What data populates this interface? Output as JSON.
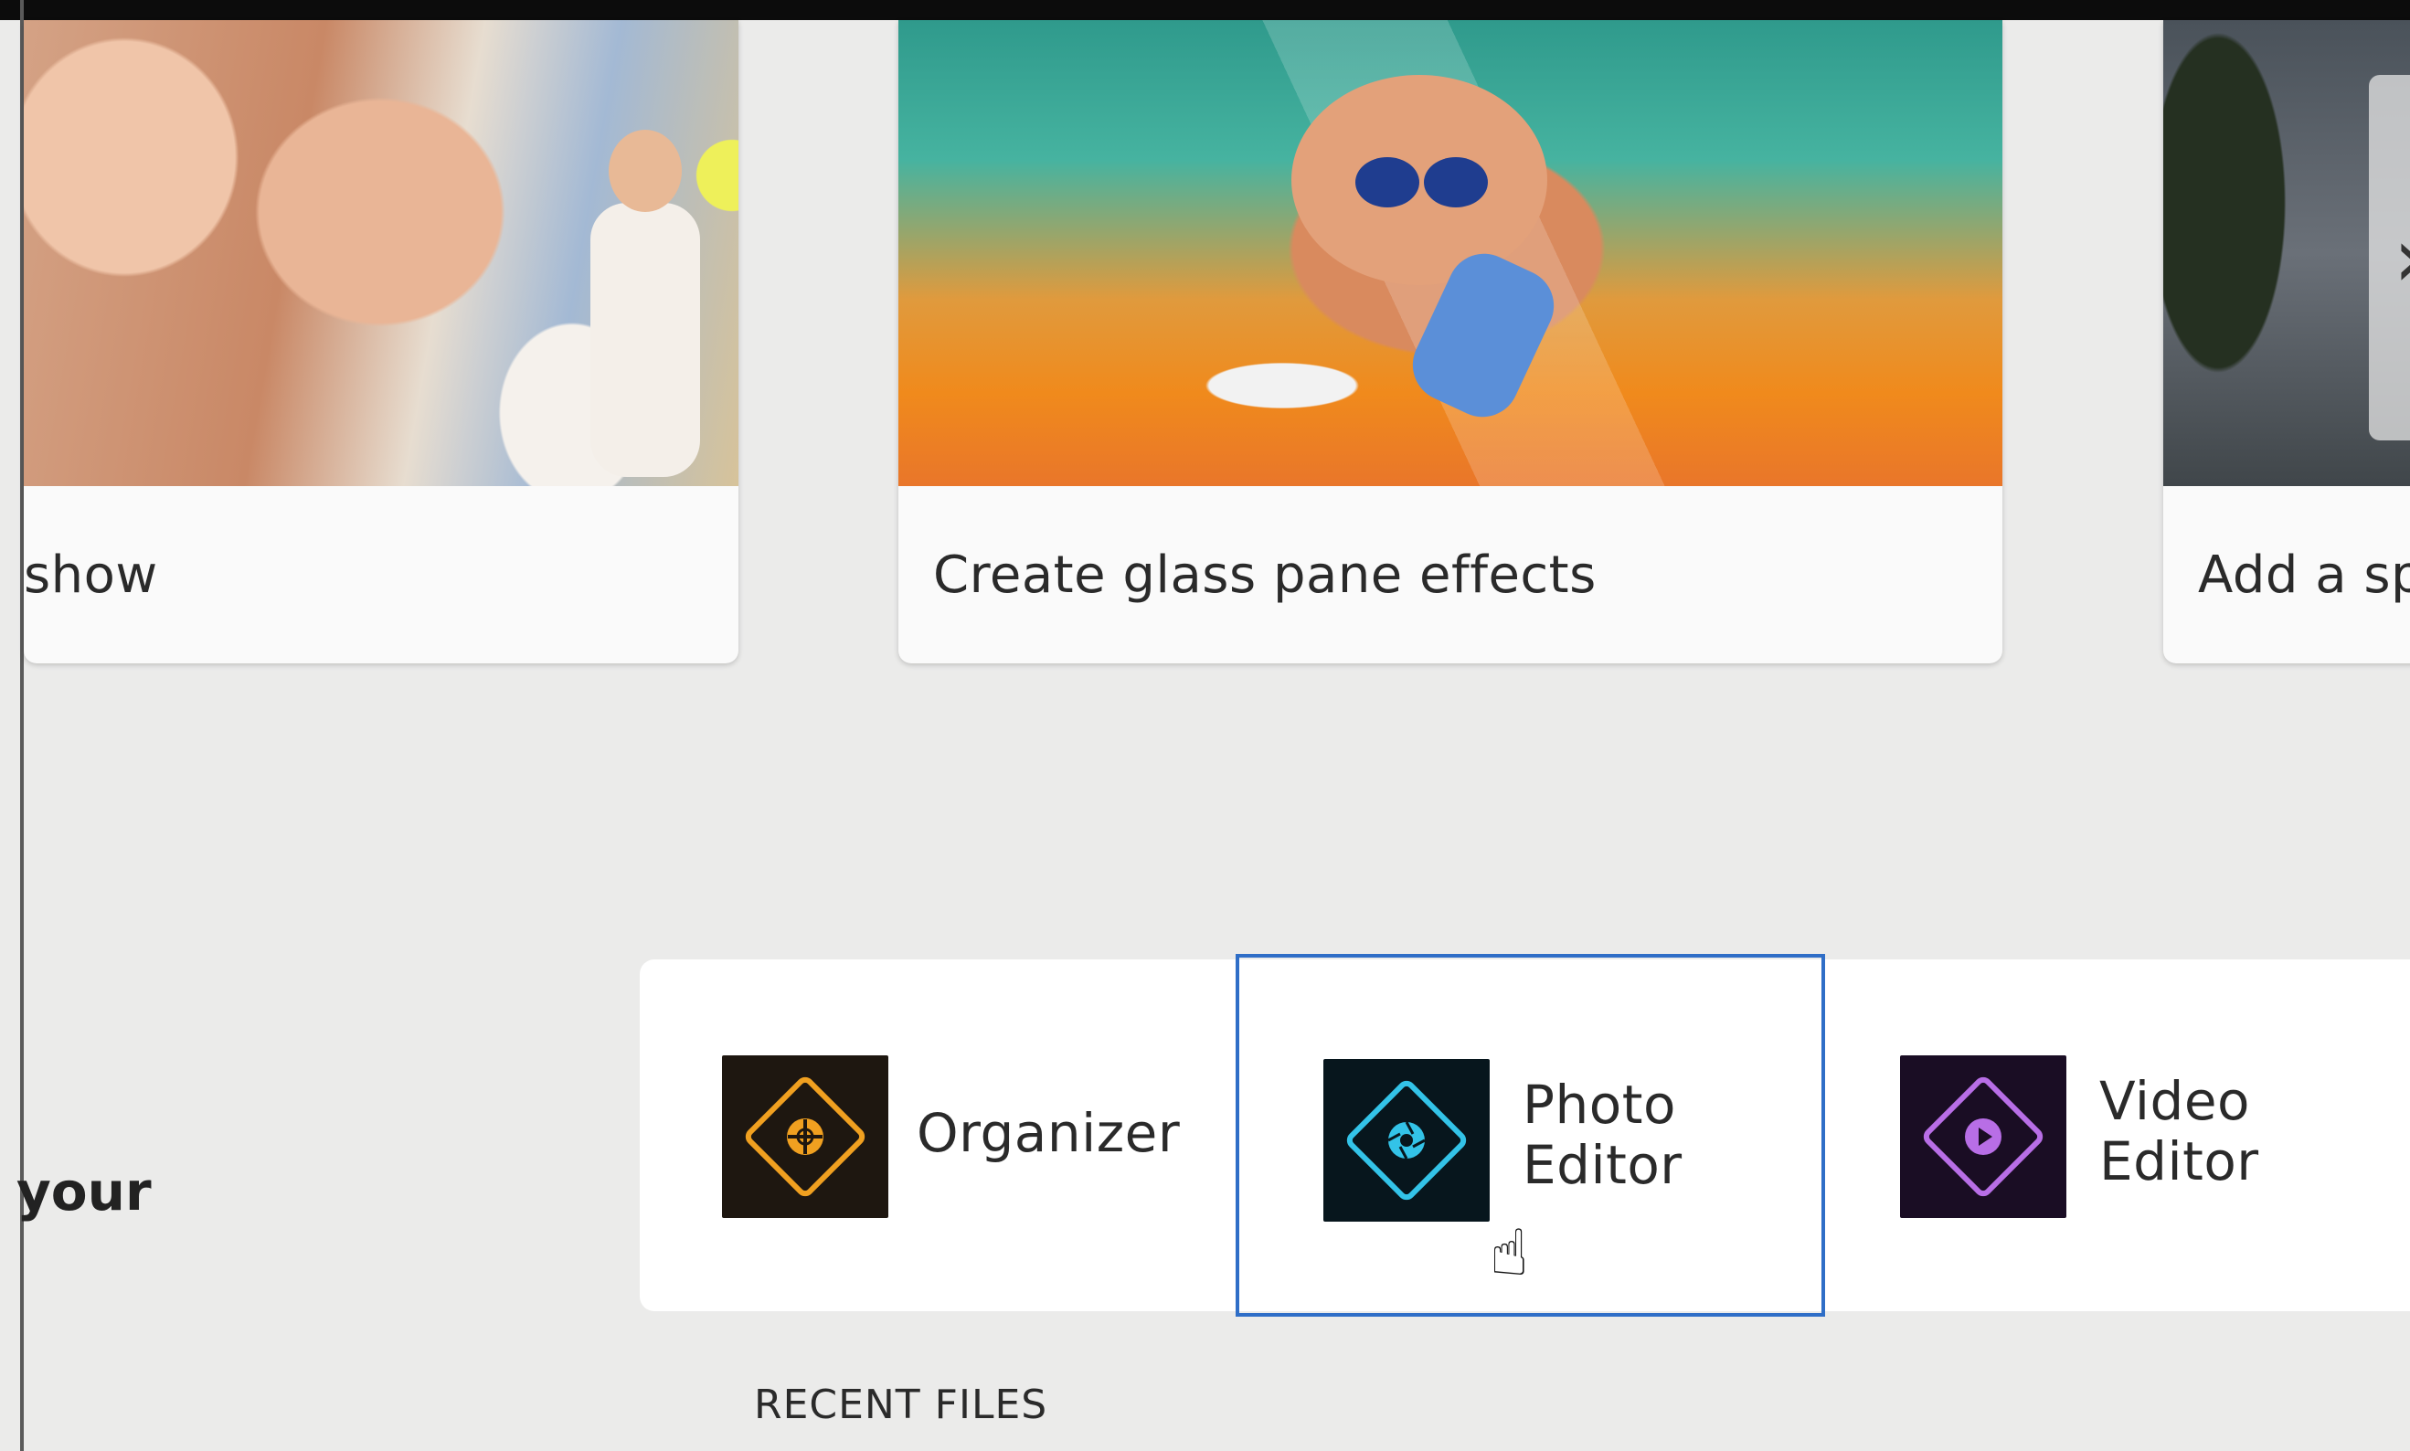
{
  "tutorials": [
    {
      "caption": "show"
    },
    {
      "caption": "Create glass pane effects"
    },
    {
      "caption": "Add a sp"
    }
  ],
  "carousel": {
    "next_icon": "chevron-right-icon",
    "next_glyph": "›"
  },
  "welcome_fragment": "your",
  "launch": {
    "organizer": {
      "line1": "Organizer",
      "icon": "organizer-icon",
      "color": "#f0a020",
      "bg": "#1e1710"
    },
    "photo_editor": {
      "line1": "Photo",
      "line2": "Editor",
      "icon": "photo-editor-icon",
      "color": "#33c3e8",
      "bg": "#07161d"
    },
    "video_editor": {
      "line1": "Video",
      "line2": "Editor",
      "icon": "video-editor-icon",
      "color": "#b86ee6",
      "bg": "#1a0d24"
    }
  },
  "recent_files": "RECENT FILES",
  "colors": {
    "selection_border": "#2f6ec7",
    "background": "#ebebea"
  }
}
